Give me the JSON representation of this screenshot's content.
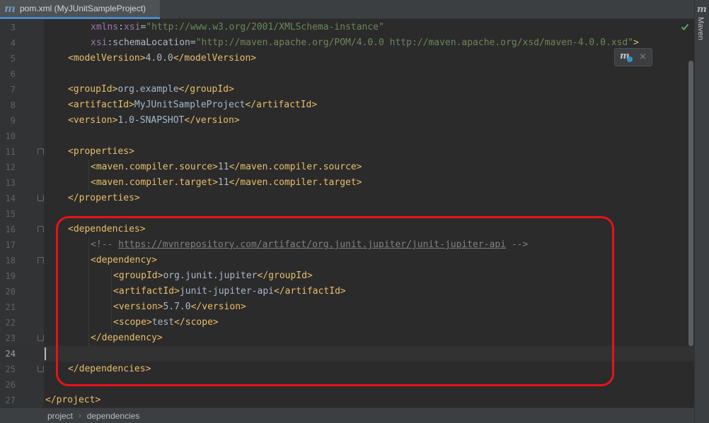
{
  "tab": {
    "icon": "maven-m-icon",
    "icon_glyph": "m",
    "title": "pom.xml (MyJUnitSampleProject)"
  },
  "right_panel": {
    "icon_glyph": "m",
    "label": "Maven"
  },
  "maven_popup": {
    "icon_glyph": "m",
    "close_glyph": "×"
  },
  "editor": {
    "lines": [
      {
        "n": "3",
        "indent": 2,
        "tokens": [
          [
            "t-ns",
            "xmlns"
          ],
          [
            "t-text",
            ":"
          ],
          [
            "t-ns",
            "xsi"
          ],
          [
            "t-text",
            "="
          ],
          [
            "t-val",
            "\"http://www.w3.org/2001/XMLSchema-instance\""
          ]
        ]
      },
      {
        "n": "4",
        "indent": 2,
        "tokens": [
          [
            "t-ns",
            "xsi"
          ],
          [
            "t-text",
            ":schemaLocation="
          ],
          [
            "t-val",
            "\"http://maven.apache.org/POM/4.0.0 http://maven.apache.org/xsd/maven-4.0.0.xsd\""
          ],
          [
            "t-tag",
            ">"
          ]
        ]
      },
      {
        "n": "5",
        "indent": 1,
        "tokens": [
          [
            "t-tag",
            "<modelVersion>"
          ],
          [
            "t-text",
            "4.0.0"
          ],
          [
            "t-tag",
            "</modelVersion>"
          ]
        ]
      },
      {
        "n": "6",
        "indent": 0,
        "tokens": []
      },
      {
        "n": "7",
        "indent": 1,
        "tokens": [
          [
            "t-tag",
            "<groupId>"
          ],
          [
            "t-text",
            "org.example"
          ],
          [
            "t-tag",
            "</groupId>"
          ]
        ]
      },
      {
        "n": "8",
        "indent": 1,
        "tokens": [
          [
            "t-tag",
            "<artifactId>"
          ],
          [
            "t-text",
            "MyJUnitSampleProject"
          ],
          [
            "t-tag",
            "</artifactId>"
          ]
        ]
      },
      {
        "n": "9",
        "indent": 1,
        "tokens": [
          [
            "t-tag",
            "<version>"
          ],
          [
            "t-text",
            "1.0-SNAPSHOT"
          ],
          [
            "t-tag",
            "</version>"
          ]
        ]
      },
      {
        "n": "10",
        "indent": 0,
        "tokens": []
      },
      {
        "n": "11",
        "indent": 1,
        "fold": "start",
        "tokens": [
          [
            "t-tag",
            "<properties>"
          ]
        ]
      },
      {
        "n": "12",
        "indent": 2,
        "tokens": [
          [
            "t-tag",
            "<maven.compiler.source>"
          ],
          [
            "t-text",
            "11"
          ],
          [
            "t-tag",
            "</maven.compiler.source>"
          ]
        ]
      },
      {
        "n": "13",
        "indent": 2,
        "tokens": [
          [
            "t-tag",
            "<maven.compiler.target>"
          ],
          [
            "t-text",
            "11"
          ],
          [
            "t-tag",
            "</maven.compiler.target>"
          ]
        ]
      },
      {
        "n": "14",
        "indent": 1,
        "fold": "end",
        "tokens": [
          [
            "t-tag",
            "</properties>"
          ]
        ]
      },
      {
        "n": "15",
        "indent": 0,
        "tokens": []
      },
      {
        "n": "16",
        "indent": 1,
        "fold": "start",
        "tokens": [
          [
            "t-tag",
            "<dependencies>"
          ]
        ]
      },
      {
        "n": "17",
        "indent": 2,
        "tokens": [
          [
            "t-cm",
            "<!-- "
          ],
          [
            "t-link",
            "https://mvnrepository.com/artifact/org.junit.jupiter/junit-jupiter-api"
          ],
          [
            "t-cm",
            " -->"
          ]
        ]
      },
      {
        "n": "18",
        "indent": 2,
        "fold": "start",
        "tokens": [
          [
            "t-tag",
            "<dependency>"
          ]
        ]
      },
      {
        "n": "19",
        "indent": 3,
        "tokens": [
          [
            "t-tag",
            "<groupId>"
          ],
          [
            "t-text",
            "org.junit.jupiter"
          ],
          [
            "t-tag",
            "</groupId>"
          ]
        ]
      },
      {
        "n": "20",
        "indent": 3,
        "tokens": [
          [
            "t-tag",
            "<artifactId>"
          ],
          [
            "t-text",
            "junit-jupiter-api"
          ],
          [
            "t-tag",
            "</artifactId>"
          ]
        ]
      },
      {
        "n": "21",
        "indent": 3,
        "tokens": [
          [
            "t-tag",
            "<version>"
          ],
          [
            "t-text",
            "5.7.0"
          ],
          [
            "t-tag",
            "</version>"
          ]
        ]
      },
      {
        "n": "22",
        "indent": 3,
        "tokens": [
          [
            "t-tag",
            "<scope>"
          ],
          [
            "t-text",
            "test"
          ],
          [
            "t-tag",
            "</scope>"
          ]
        ]
      },
      {
        "n": "23",
        "indent": 2,
        "fold": "end",
        "tokens": [
          [
            "t-tag",
            "</dependency>"
          ]
        ]
      },
      {
        "n": "24",
        "indent": 0,
        "current": true,
        "tokens": []
      },
      {
        "n": "25",
        "indent": 1,
        "fold": "end",
        "tokens": [
          [
            "t-tag",
            "</dependencies>"
          ]
        ]
      },
      {
        "n": "26",
        "indent": 0,
        "tokens": []
      },
      {
        "n": "27",
        "indent": 0,
        "tokens": [
          [
            "t-tag",
            "</project>"
          ]
        ]
      }
    ]
  },
  "breadcrumb": {
    "items": [
      "project",
      "dependencies"
    ],
    "separator": "›"
  },
  "colors": {
    "highlight": "#e8131a",
    "tag": "#e8bf6a",
    "value": "#6a8759",
    "namespace": "#9876aa",
    "check": "#59a869"
  }
}
